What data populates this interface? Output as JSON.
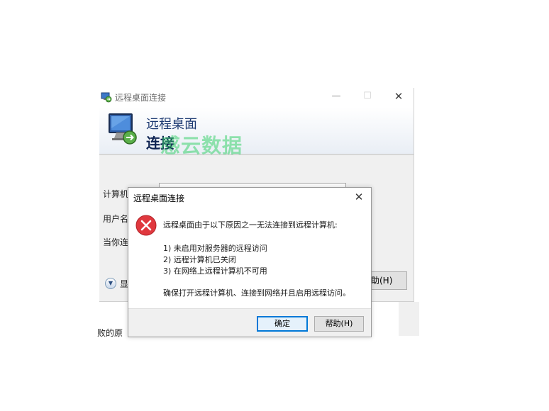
{
  "window": {
    "title": "远程桌面连接",
    "minimize_glyph": "—",
    "maximize_glyph": "☐",
    "close_glyph": "✕",
    "banner_line1": "远程桌面",
    "banner_line2": "连接",
    "watermark": "感云数据"
  },
  "form": {
    "computer_label": "计算机",
    "username_label": "用户名",
    "connect_note_label": "当你连",
    "show_options_label": "显",
    "help_button_label": "助(H)"
  },
  "background_text": "败的原",
  "dialog": {
    "title": "远程桌面连接",
    "close_glyph": "✕",
    "message_header": "远程桌面由于以下原因之一无法连接到远程计算机:",
    "reasons": [
      "1) 未启用对服务器的远程访问",
      "2) 远程计算机已关闭",
      "3) 在网络上远程计算机不可用"
    ],
    "advice": "确保打开远程计算机、连接到网络并且启用远程访问。",
    "ok_label": "确定",
    "help_label": "帮助(H)"
  },
  "colors": {
    "banner_text": "#1d3a72",
    "watermark": "#3cd26e",
    "error_red": "#e0383e",
    "accent_blue": "#0078d7"
  },
  "icons": {
    "title_icon": "remote-desktop-icon",
    "banner_icon": "monitor-icon",
    "error_icon": "error-icon"
  }
}
